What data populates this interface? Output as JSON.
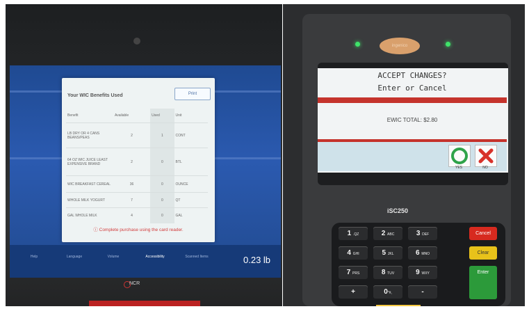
{
  "kiosk": {
    "dialog": {
      "title": "Your WIC Benefits Used",
      "print_label": "Print",
      "columns": [
        "Benefit",
        "Available",
        "Used",
        "Unit"
      ],
      "rows": [
        {
          "benefit": "LB DRY OR 4 CANS BEANS/PEAS",
          "available": "2",
          "used": "1",
          "unit": "CONT"
        },
        {
          "benefit": "64 OZ WIC JUICE LEAST EXPENSIVE BRAND",
          "available": "2",
          "used": "0",
          "unit": "BTL"
        },
        {
          "benefit": "WIC BREAKFAST CEREAL",
          "available": "36",
          "used": "0",
          "unit": "OUNCE"
        },
        {
          "benefit": "WHOLE MILK YOGURT",
          "available": "7",
          "used": "0",
          "unit": "QT"
        },
        {
          "benefit": "GAL WHOLE MILK",
          "available": "4",
          "used": "0",
          "unit": "GAL"
        }
      ],
      "footer": "Complete purchase using the card reader."
    },
    "taskbar": [
      "Help",
      "Language",
      "Volume",
      "Accessibility",
      "Scanned Items"
    ],
    "weight": "0.23 lb",
    "brand": "NCR",
    "accent_color": "#d23b3b"
  },
  "reader": {
    "logo": "ingenico",
    "prompt_line1": "ACCEPT CHANGES?",
    "prompt_line2": "Enter or Cancel",
    "total": "EWIC TOTAL: $2.80",
    "yes_label": "YES",
    "no_label": "NO",
    "model": "iSC250",
    "keys": [
      {
        "main": "1",
        "sub": ".QZ"
      },
      {
        "main": "2",
        "sub": "ABC"
      },
      {
        "main": "3",
        "sub": "DEF"
      },
      {
        "main": "4",
        "sub": "GHI"
      },
      {
        "main": "5",
        "sub": "JKL"
      },
      {
        "main": "6",
        "sub": "MNO"
      },
      {
        "main": "7",
        "sub": "PRS"
      },
      {
        "main": "8",
        "sub": "TUV"
      },
      {
        "main": "9",
        "sub": "WXY"
      },
      {
        "main": "+",
        "sub": ""
      },
      {
        "main": "0",
        "sub": "\"#,"
      },
      {
        "main": "-",
        "sub": ""
      }
    ],
    "function_keys": [
      {
        "label": "Cancel",
        "color": "#d72a1f"
      },
      {
        "label": "Clear",
        "color": "#e8c21a"
      },
      {
        "label": "Enter",
        "color": "#2c9a3a"
      }
    ]
  }
}
